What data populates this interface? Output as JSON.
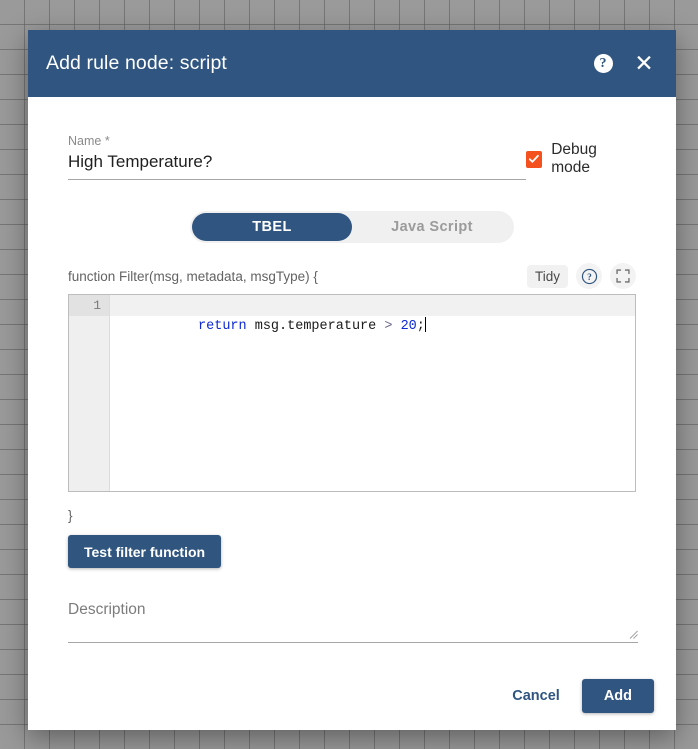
{
  "header": {
    "title": "Add rule node: script",
    "help_icon": "help-circle-icon",
    "close_icon": "close-icon",
    "background_color": "#2f5580"
  },
  "form": {
    "name": {
      "label": "Name *",
      "value": "High Temperature?",
      "placeholder": ""
    },
    "debug": {
      "label": "Debug mode",
      "checked": true,
      "checkbox_color": "#f4511e"
    }
  },
  "language_toggle": {
    "options": [
      {
        "label": "TBEL",
        "selected": true
      },
      {
        "label": "Java Script",
        "selected": false
      }
    ],
    "selected_color": "#2f5580",
    "track_color": "#f0f0f0"
  },
  "code_panel": {
    "signature": "function Filter(msg, metadata, msgType) {",
    "closing_brace": "}",
    "toolbar": {
      "tidy_label": "Tidy",
      "help_icon": "help-circle-outline-icon",
      "fullscreen_icon": "fullscreen-icon"
    },
    "editor": {
      "line_number": "1",
      "tokens": [
        {
          "text": "return",
          "type": "keyword"
        },
        {
          "text": " msg.temperature ",
          "type": "plain"
        },
        {
          "text": ">",
          "type": "operator"
        },
        {
          "text": " ",
          "type": "plain"
        },
        {
          "text": "20",
          "type": "number"
        },
        {
          "text": ";",
          "type": "plain"
        }
      ],
      "full_text": "return msg.temperature > 20;"
    }
  },
  "test_button": {
    "label": "Test filter function",
    "color": "#305680"
  },
  "description": {
    "placeholder": "Description",
    "value": ""
  },
  "footer": {
    "cancel_label": "Cancel",
    "add_label": "Add",
    "add_color": "#2f5580"
  }
}
